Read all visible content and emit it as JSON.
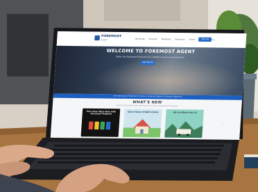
{
  "site": {
    "logo_text": "FOREMOST",
    "logo_sub": "AGENT",
    "nav": [
      "Get Quote",
      "Products",
      "Marketing",
      "Resources",
      "Claims",
      "Training Agency"
    ],
    "signup_label": "Sign Up"
  },
  "hero": {
    "title": "WELCOME TO FOREMOST AGENT",
    "subtitle": "Make the Foremost Choice® for a better insurance experience!",
    "button_label": "Get Started"
  },
  "banner_text": "Get news about Foremost's Choice in Foremost Agent & Foremost Signature",
  "whats_new": {
    "title": "WHAT'S NEW",
    "subtitle": "Check out the latest tools and resources to help you grow your business"
  },
  "cards": [
    {
      "title": "Earn Even More Now with Foremost Property"
    },
    {
      "title": "Get A Home of Both Choice"
    },
    {
      "title": "We Go Where You Go"
    }
  ],
  "colors": {
    "accent": "#2a6cc8",
    "banner": "#1d5fc0",
    "desk": "#a8743f"
  }
}
